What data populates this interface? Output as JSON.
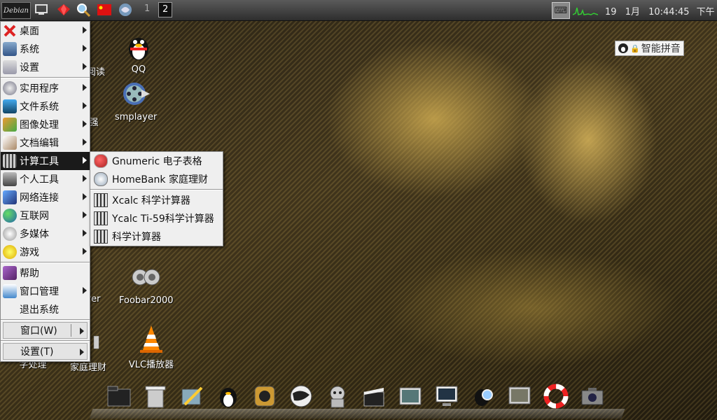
{
  "taskbar": {
    "logo": "Debian",
    "workspaces": [
      "1",
      "2"
    ],
    "active_workspace": "2",
    "clock": {
      "day": "19",
      "month": "1月",
      "time": "10:44:45",
      "ampm": "下午"
    }
  },
  "ime": {
    "label": "智能拼音"
  },
  "desktop_icons": [
    {
      "label": "QQ",
      "icon": "penguin-icon"
    },
    {
      "label": "smplayer",
      "icon": "film-reel-icon"
    },
    {
      "label": "Foobar2000",
      "icon": "speakers-icon"
    },
    {
      "label": "VLC播放器",
      "icon": "traffic-cone-icon"
    },
    {
      "label": "家庭理财",
      "icon": "calculator-icon"
    },
    {
      "label": "阅读",
      "icon": "book-icon"
    },
    {
      "label": "强",
      "icon": "app-icon"
    },
    {
      "label": "yer",
      "icon": "app-icon"
    },
    {
      "label": "字处理",
      "icon": "app-icon"
    }
  ],
  "menu": {
    "items": [
      {
        "label": "桌面",
        "submenu": true,
        "icon": "desktop-icon"
      },
      {
        "label": "系统",
        "submenu": true,
        "icon": "system-icon"
      },
      {
        "label": "设置",
        "submenu": true,
        "icon": "settings-icon"
      },
      {
        "label": "实用程序",
        "submenu": true,
        "icon": "utilities-icon"
      },
      {
        "label": "文件系统",
        "submenu": true,
        "icon": "filesystem-icon"
      },
      {
        "label": "图像处理",
        "submenu": true,
        "icon": "image-icon"
      },
      {
        "label": "文档编辑",
        "submenu": true,
        "icon": "document-icon"
      },
      {
        "label": "计算工具",
        "submenu": true,
        "icon": "calculator-icon",
        "selected": true
      },
      {
        "label": "个人工具",
        "submenu": true,
        "icon": "personal-icon"
      },
      {
        "label": "网络连接",
        "submenu": true,
        "icon": "network-icon"
      },
      {
        "label": "互联网",
        "submenu": true,
        "icon": "globe-icon"
      },
      {
        "label": "多媒体",
        "submenu": true,
        "icon": "multimedia-icon"
      },
      {
        "label": "游戏",
        "submenu": true,
        "icon": "games-icon"
      },
      {
        "label": "帮助",
        "submenu": false,
        "icon": "help-icon"
      },
      {
        "label": "窗口管理",
        "submenu": true,
        "icon": "window-icon"
      },
      {
        "label": "退出系统",
        "submenu": false,
        "icon": ""
      }
    ],
    "window_label": "窗口(W)",
    "settings_label": "设置(T)"
  },
  "submenu": {
    "items": [
      {
        "label": "Gnumeric 电子表格",
        "icon": "spreadsheet-icon"
      },
      {
        "label": "HomeBank 家庭理财",
        "icon": "homebank-icon"
      },
      {
        "label": "Xcalc 科学计算器",
        "icon": "calculator-icon"
      },
      {
        "label": "Ycalc Ti-59科学计算器",
        "icon": "calculator-icon"
      },
      {
        "label": "科学计算器",
        "icon": "calculator-icon"
      }
    ]
  },
  "dock": {
    "items": [
      "folder-icon",
      "trash-icon",
      "pencil-icon",
      "penguin-icon",
      "music-icon",
      "globe-icon",
      "robot-icon",
      "clapper-icon",
      "photo-icon",
      "monitor-icon",
      "search-icon",
      "screen-icon",
      "lifebuoy-icon",
      "camera-icon"
    ]
  },
  "colors": {
    "menu_bg": "#efefef",
    "menu_selected": "#1a1a1a",
    "taskbar": "#3a3a3a"
  }
}
